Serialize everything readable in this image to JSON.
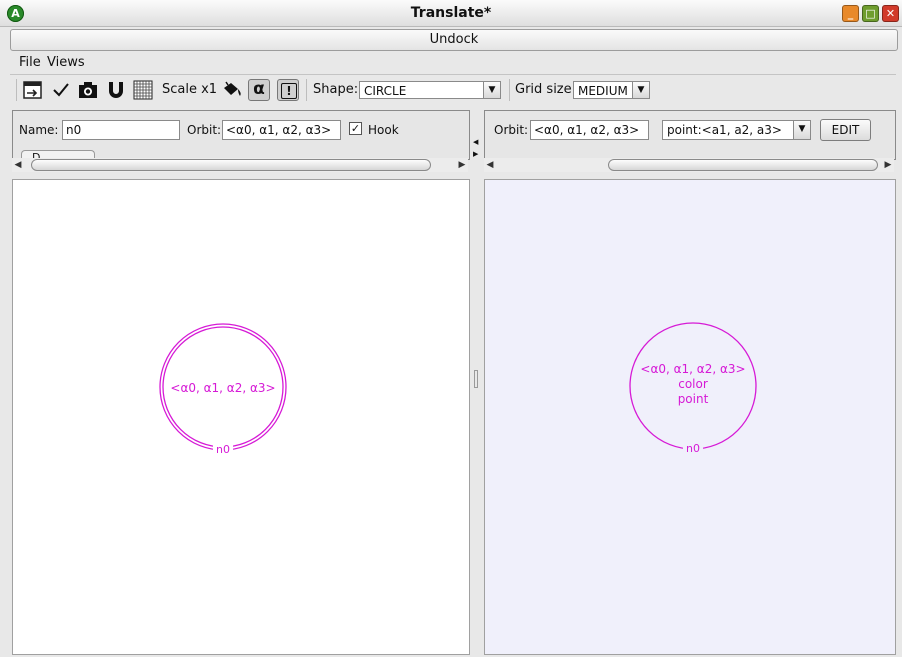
{
  "window": {
    "title": "Translate*",
    "app_icon": "A"
  },
  "undock_label": "Undock",
  "menu": [
    "File",
    "Views"
  ],
  "toolbar": {
    "scale_label": "Scale x1",
    "alpha_glyph": "α",
    "bang_glyph": "!",
    "shape_label": "Shape:",
    "shape_value": "CIRCLE",
    "grid_label": "Grid size:",
    "grid_value": "MEDIUM"
  },
  "left_panel": {
    "name_label": "Name:",
    "name_value": "n0",
    "orbit_label": "Orbit:",
    "orbit_value": "<α0, α1, α2, α3>",
    "hook_label": "Hook",
    "hook_checked": true,
    "partial_tab": "D...",
    "node_orbit": "<α0, α1, α2, α3>",
    "node_name": "n0"
  },
  "right_panel": {
    "orbit_label": "Orbit:",
    "orbit_value": "<α0, α1, α2, α3>",
    "point_value": "point:<a1, a2, a3>",
    "edit_label": "EDIT",
    "node_orbit": "<α0, α1, α2, α3>",
    "node_line2": "color",
    "node_line3": "point",
    "node_name": "n0"
  },
  "colors": {
    "node": "#d61ad6",
    "right_canvas_bg": "#f0f0fb"
  }
}
